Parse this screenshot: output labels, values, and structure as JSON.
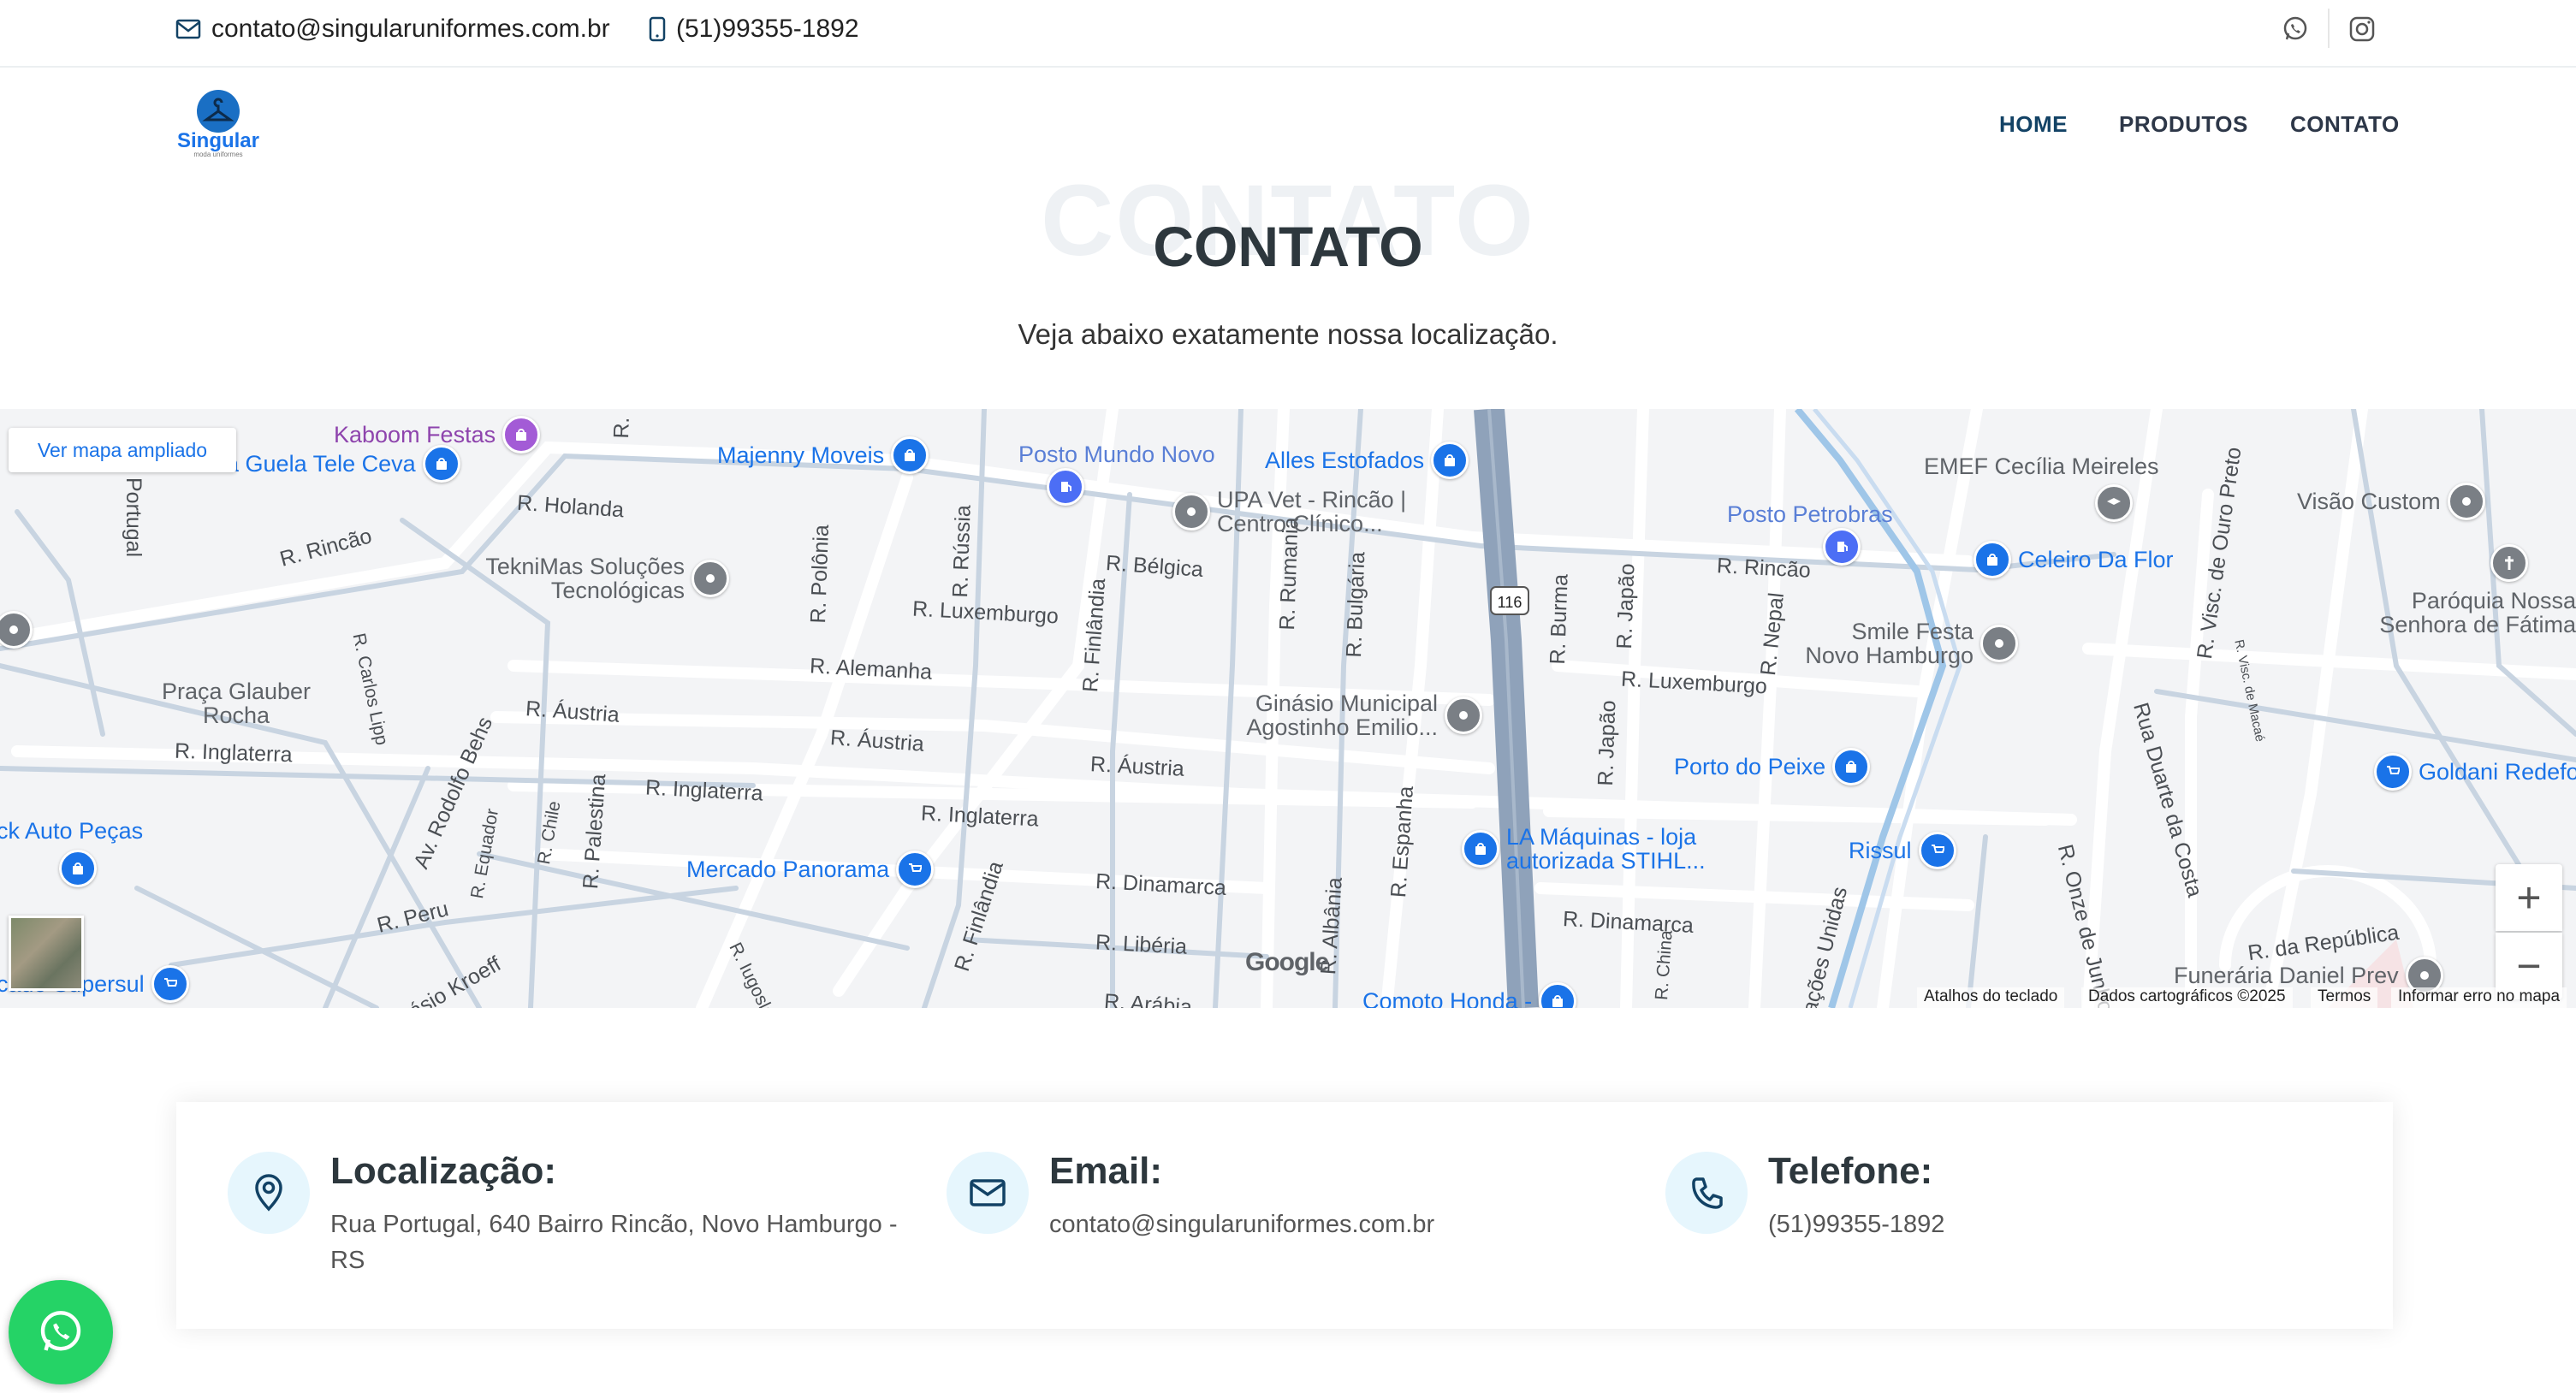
{
  "topbar": {
    "email": "contato@singularuniformes.com.br",
    "phone": "(51)99355-1892",
    "social_icons": [
      "whatsapp-icon",
      "instagram-icon"
    ]
  },
  "brand": {
    "logo_text": "Singular",
    "logo_subtext": "moda uniformes"
  },
  "nav": {
    "items": [
      {
        "label": "HOME",
        "active": true
      },
      {
        "label": "PRODUTOS",
        "active": false
      },
      {
        "label": "CONTATO",
        "active": false
      }
    ]
  },
  "section": {
    "ghost_title": "CONTATO",
    "title": "CONTATO",
    "subtitle": "Veja abaixo exatamente nossa localização."
  },
  "map": {
    "enlarge_label": "Ver mapa ampliado",
    "zoom_in": "+",
    "zoom_out": "−",
    "google_label": "Google",
    "attribution": {
      "shortcuts": "Atalhos do teclado",
      "data": "Dados cartográficos ©2025",
      "terms": "Termos",
      "report": "Informar erro no mapa"
    },
    "streets": [
      "R. Holanda",
      "R. Rincão",
      "Portugal",
      "R. Bélgica",
      "R. Luxemburgo",
      "R. Alemanha",
      "R. Áustria",
      "R. Áustria",
      "R. Áustria",
      "R. Inglaterra",
      "R. Inglaterra",
      "R. Inglaterra",
      "R. Dinamarca",
      "R. Dinamarca",
      "R. Libéria",
      "R. Peru",
      "R. Polônia",
      "R. Rússia",
      "R. Finlândia",
      "R. Rumania",
      "R. Bulgária",
      "R. Burma",
      "R. Japão",
      "R. Japão",
      "R. Nepal",
      "R. Luxemburgo",
      "R. Rincão",
      "R. Visc. de Ouro Preto",
      "Rua Duarte da Costa",
      "R. Onze de Junho",
      "R. da República",
      "R. Espanha",
      "R. Albânia",
      "R. Palestina",
      "R. Chile",
      "R. Equador",
      "Av. Rodolfo Behs",
      "R. Carlos Lipp",
      "R. Iugoslávia",
      "R. Finlândia",
      "R. Arábia",
      "Ginásio Kroeff",
      "R. China",
      "Nações Unidas",
      "R. Visc. de Macaé",
      "R."
    ],
    "pois": [
      {
        "label": "Kaboom Festas",
        "icon": "shopping-bag-icon"
      },
      {
        "label": "Gela Guela Tele Ceva",
        "icon": "shopping-bag-icon"
      },
      {
        "label": "Majenny Moveis",
        "icon": "shopping-bag-icon"
      },
      {
        "label": "Posto Mundo Novo",
        "icon": "fuel-icon"
      },
      {
        "label": "Alles Estofados",
        "icon": "shopping-bag-icon"
      },
      {
        "label": "UPA Vet - Rincão | Centro Clínico...",
        "icon": "place-icon"
      },
      {
        "label": "TekniMas Soluções Tecnológicas",
        "icon": "place-icon"
      },
      {
        "label": "EMEF Cecília Meireles",
        "icon": "school-icon"
      },
      {
        "label": "Posto Petrobras",
        "icon": "fuel-icon"
      },
      {
        "label": "Celeiro Da Flor",
        "icon": "shopping-bag-icon"
      },
      {
        "label": "Visão Custom",
        "icon": "place-icon"
      },
      {
        "label": "Paróquia Nossa Senhora de Fátima",
        "icon": "church-icon"
      },
      {
        "label": "Smile Festa Novo Hamburgo",
        "icon": "place-icon"
      },
      {
        "label": "Praça Glauber Rocha",
        "icon": "park"
      },
      {
        "label": "Ginásio Municipal Agostinho Emilio...",
        "icon": "place-icon"
      },
      {
        "label": "Porto do Peixe",
        "icon": "shopping-bag-icon"
      },
      {
        "label": "Goldani Redefor",
        "icon": "cart-icon"
      },
      {
        "label": "ck Auto Peças",
        "icon": "shopping-bag-icon"
      },
      {
        "label": "Mercado Panorama",
        "icon": "cart-icon"
      },
      {
        "label": "LA Máquinas - loja autorizada STIHL...",
        "icon": "shopping-bag-icon"
      },
      {
        "label": "Rissul",
        "icon": "cart-icon"
      },
      {
        "label": "Funerária Daniel Prev",
        "icon": "place-icon"
      },
      {
        "label": "Comoto Honda -",
        "icon": "shopping-bag-icon"
      },
      {
        "label": "cado Supersul",
        "icon": "cart-icon"
      }
    ],
    "highway_shield": "116"
  },
  "info": {
    "location": {
      "title": "Localização:",
      "line1": "Rua Portugal, 640 Bairro Rincão, Novo Hamburgo -",
      "line2": "RS",
      "icon": "map-pin-icon"
    },
    "email": {
      "title": "Email:",
      "text": "contato@singularuniformes.com.br",
      "icon": "envelope-icon"
    },
    "phone": {
      "title": "Telefone:",
      "text": "(51)99355-1892",
      "icon": "phone-icon"
    }
  },
  "colors": {
    "nav_active": "#124265",
    "icon_bg": "#e6f6fd",
    "icon_fg": "#124265",
    "whatsapp": "#25d366",
    "map_link": "#1a73e8"
  }
}
